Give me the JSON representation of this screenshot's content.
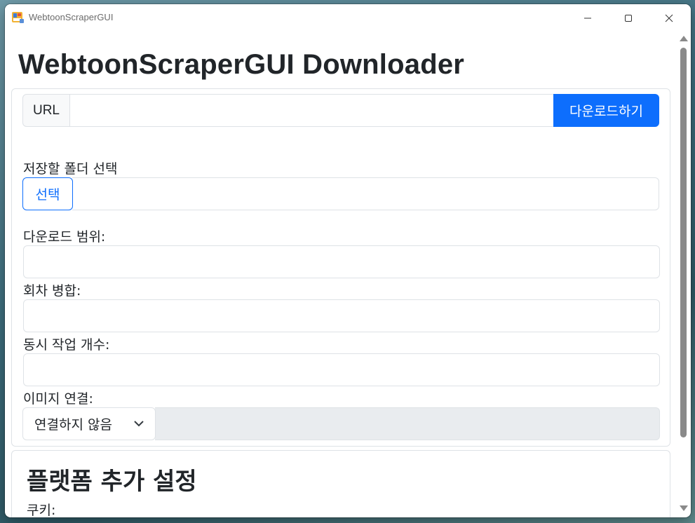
{
  "window": {
    "title": "WebtoonScraperGUI",
    "controls": [
      "minimize-icon",
      "maximize-icon",
      "close-icon"
    ]
  },
  "page": {
    "title": "WebtoonScraperGUI Downloader"
  },
  "url_section": {
    "addon_label": "URL",
    "input_value": "",
    "download_button": "다운로드하기"
  },
  "folder_section": {
    "label": "저장할 폴더 선택",
    "select_button": "선택",
    "path_value": ""
  },
  "download_range": {
    "label": "다운로드 범위:",
    "value": ""
  },
  "merge_episodes": {
    "label": "회차 병합:",
    "value": ""
  },
  "concurrent_tasks": {
    "label": "동시 작업 개수:",
    "value": ""
  },
  "image_concat": {
    "label": "이미지 연결:",
    "selected": "연결하지 않음",
    "extra_value": ""
  },
  "platform_settings": {
    "title": "플랫폼 추가 설정",
    "cookie_label": "쿠키:"
  },
  "colors": {
    "primary": "#0d6efd",
    "border": "#dee2e6",
    "disabled_bg": "#e9ecef",
    "text": "#212529"
  }
}
